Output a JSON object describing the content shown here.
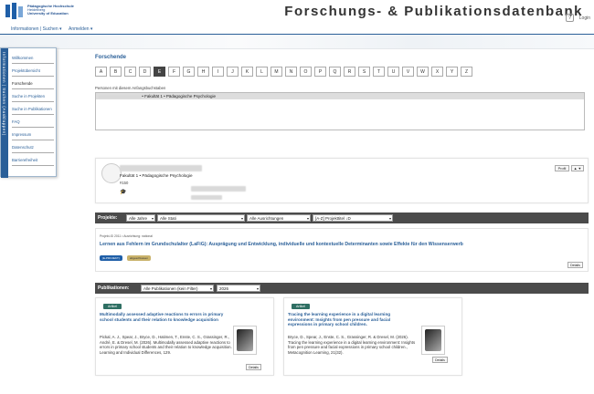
{
  "header": {
    "univ_lines": [
      "Pädagogische Hochschule",
      "Heidelberg",
      "University of Education"
    ],
    "title": "Forschungs- & Publikationsdatenbank",
    "help": "?",
    "login": "Login"
  },
  "topnav": {
    "items": [
      "Informationen | Suchen",
      "Anmelden"
    ]
  },
  "sidebar": {
    "vertical_label": "Informationen | Suchen (Ausklappen)",
    "items": [
      "Willkommen",
      "Projektübersicht",
      "Forschende",
      "Suche in Projekten",
      "Suche in Publikationen",
      "FAQ",
      "Impressum",
      "Datenschutz",
      "Barrierefreiheit"
    ]
  },
  "main": {
    "title": "Forschende",
    "letters": [
      "A",
      "B",
      "C",
      "D",
      "E",
      "F",
      "G",
      "H",
      "I",
      "J",
      "K",
      "L",
      "M",
      "N",
      "O",
      "P",
      "Q",
      "R",
      "S",
      "T",
      "U",
      "V",
      "W",
      "X",
      "Y",
      "Z"
    ],
    "active_letter": "E",
    "list_label": "Personen mit diesem Anfangsbuchstaben",
    "list_selected_suffix": " • Fakultät 1 • Pädagogische Psychologie"
  },
  "person": {
    "faculty": "Fakultät 1 • Pädagogische Psychologie",
    "id": "#150",
    "btn_profile": "Profil",
    "btn_pdf": "▲ ▼"
  },
  "projects_bar": {
    "label": "Projekte:",
    "filters": [
      "Alle Jahre",
      "Alle Stati",
      "Alle Ausrichtungen",
      "[A-Z] Projekttitel ↓D"
    ]
  },
  "project": {
    "meta": "Projekt-ID 2011 • Ausrichtung: national",
    "title": "Lernen aus Fehlern im Grundschulalter (LaFiG): Ausprägung und Entwicklung, individuelle und kontextuelle Determinanten sowie Effekte für den Wissenserwerb",
    "tag1": "(E-PROJEKT)",
    "tag2": "abgeschlossen",
    "details": "Details"
  },
  "pubs_bar": {
    "label": "Publikationen:",
    "filters": [
      "Alle Publikationen (kein Filter)",
      "2026"
    ]
  },
  "publications": [
    {
      "type": "Artikel",
      "title": "Multimodally assessed adaptive reactions to errors in primary school students and their relation to knowledge acquisition",
      "citation": "Pickal, A. J., Spear, J., Bryce, D., Hatimen, T., Enste, C. S., Grassinger, R., André, E. & Dresel, M. (2026). Multimodally assessed adaptive reactions to errors in primary school students and their relation to knowledge acquisition. Learning and Individual Differences, 129.",
      "details": "Details"
    },
    {
      "type": "Artikel",
      "title": "Tracing the learning experience in a digital learning environment: Insights from pen pressure and facial expressions in primary school children.",
      "citation": "Bryce, D., Spear, J., Enste, C. S., Grassinger, R. & Dresel, M. (2026). Tracing the learning experience in a digital learning environment: Insights from pen pressure and facial expressions in primary school children., Metacognition Learning, 21(32).",
      "details": "Details"
    }
  ],
  "colors": {
    "brand": "#2a5f98",
    "bar": "#4b4b4b",
    "type_badge": "#2f6f63"
  }
}
